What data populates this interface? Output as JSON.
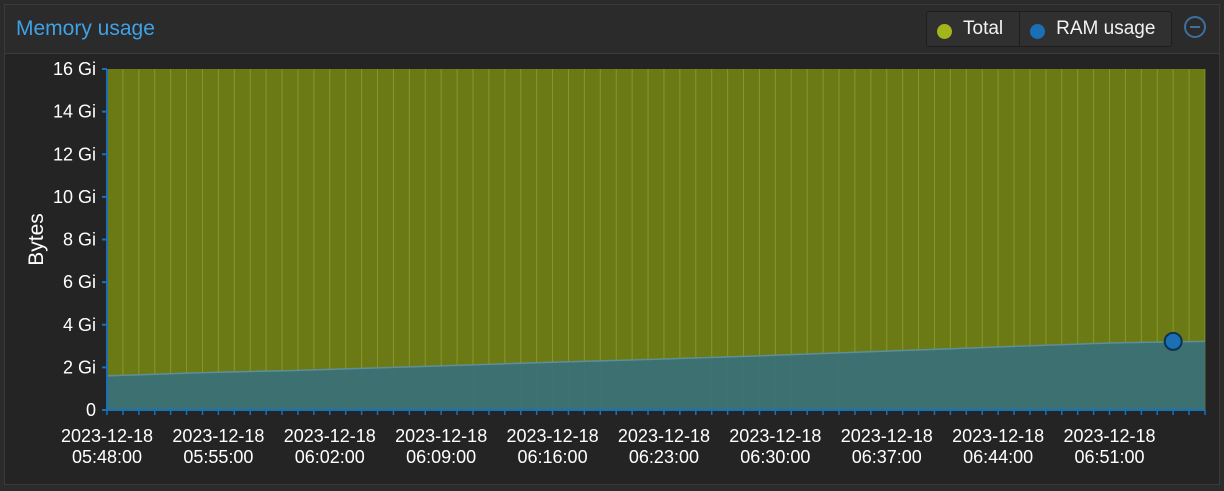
{
  "panel": {
    "title": "Memory usage",
    "legend": [
      {
        "label": "Total",
        "color": "#a3b51c"
      },
      {
        "label": "RAM usage",
        "color": "#1b6fb5"
      }
    ],
    "collapse_icon": "minus-circle-icon"
  },
  "chart_data": {
    "type": "area",
    "ylabel": "Bytes",
    "ylim": [
      0,
      16
    ],
    "y_unit": "Gi",
    "yticks": [
      "0",
      "2 Gi",
      "4 Gi",
      "6 Gi",
      "8 Gi",
      "10 Gi",
      "12 Gi",
      "14 Gi",
      "16 Gi"
    ],
    "xticks": [
      [
        "2023-12-18",
        "05:48:00"
      ],
      [
        "2023-12-18",
        "05:55:00"
      ],
      [
        "2023-12-18",
        "06:02:00"
      ],
      [
        "2023-12-18",
        "06:09:00"
      ],
      [
        "2023-12-18",
        "06:16:00"
      ],
      [
        "2023-12-18",
        "06:23:00"
      ],
      [
        "2023-12-18",
        "06:30:00"
      ],
      [
        "2023-12-18",
        "06:37:00"
      ],
      [
        "2023-12-18",
        "06:44:00"
      ],
      [
        "2023-12-18",
        "06:51:00"
      ]
    ],
    "x_range": [
      "2023-12-18 05:48:00",
      "2023-12-18 06:57:00"
    ],
    "grid": true,
    "series": [
      {
        "name": "Total",
        "color": "#6b7a14",
        "values": [
          16,
          16,
          16,
          16,
          16,
          16,
          16,
          16,
          16,
          16,
          16
        ]
      },
      {
        "name": "RAM usage",
        "color": "#3a6f7a",
        "values": [
          1.6,
          1.75,
          1.85,
          1.98,
          2.12,
          2.26,
          2.38,
          2.52,
          2.68,
          2.84,
          3.0,
          3.15,
          3.22
        ]
      }
    ],
    "highlight_point": {
      "x": "2023-12-18 06:55:00",
      "y": 3.22,
      "series": "RAM usage"
    }
  }
}
